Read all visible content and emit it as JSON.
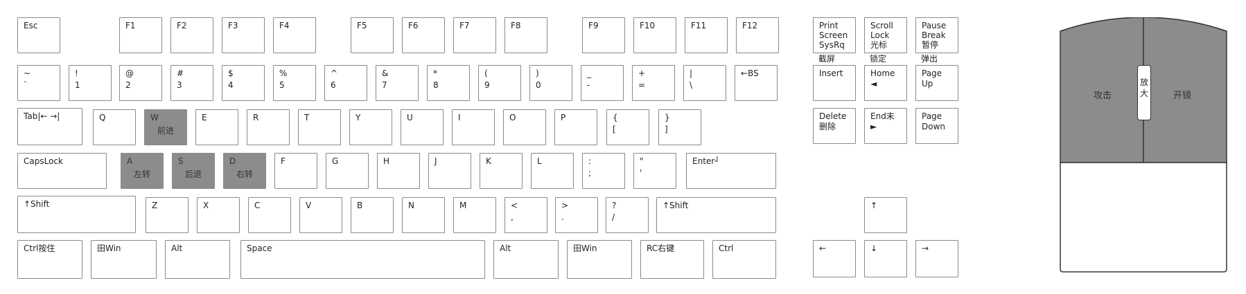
{
  "keyboard": {
    "esc": "Esc",
    "f1": "F1",
    "f2": "F2",
    "f3": "F3",
    "f4": "F4",
    "f5": "F5",
    "f6": "F6",
    "f7": "F7",
    "f8": "F8",
    "f9": "F9",
    "f10": "F10",
    "f11": "F11",
    "f12": "F12",
    "print": "Print\nScreen\nSysRq",
    "print_cn": "截屏",
    "scroll": "Scroll\nLock\n光标",
    "scroll_cn": "锁定",
    "pause": "Pause\nBreak\n暂停",
    "pause_cn": "弹出",
    "tilde_top": "~",
    "tilde_bot": "`",
    "n1_top": "!",
    "n1_bot": "1",
    "n2_top": "@",
    "n2_bot": "2",
    "n3_top": "#",
    "n3_bot": "3",
    "n4_top": "$",
    "n4_bot": "4",
    "n5_top": "%",
    "n5_bot": "5",
    "n6_top": "^",
    "n6_bot": "6",
    "n7_top": "&",
    "n7_bot": "7",
    "n8_top": "*",
    "n8_bot": "8",
    "n9_top": "(",
    "n9_bot": "9",
    "n0_top": ")",
    "n0_bot": "0",
    "minus_top": "_",
    "minus_bot": "-",
    "plus_top": "+",
    "plus_bot": "=",
    "pipe_top": "|",
    "pipe_bot": "\\",
    "backspace": "←BS",
    "insert": "Insert",
    "home": "Home\n◄",
    "pageup": "Page\nUp",
    "tab": "Tab|← →|",
    "q": "Q",
    "w": "W",
    "w_cn": "前进",
    "e": "E",
    "r": "R",
    "t": "T",
    "y": "Y",
    "u": "U",
    "i": "I",
    "o": "O",
    "p": "P",
    "lbrace_top": "{",
    "lbrace_bot": "[",
    "rbrace_top": "}",
    "rbrace_bot": "]",
    "delete": "Delete\n删除",
    "end": "End末\n►",
    "pagedown": "Page\nDown",
    "capslock": "CapsLock",
    "a": "A",
    "a_cn": "左转",
    "s": "S",
    "s_cn": "后退",
    "d": "D",
    "d_cn": "右转",
    "f": "F",
    "g": "G",
    "h": "H",
    "j": "J",
    "k": "K",
    "l": "L",
    "colon_top": ":",
    "colon_bot": ";",
    "quote_top": "\"",
    "quote_bot": "'",
    "enter": "Enter┘",
    "lshift": "↑Shift",
    "z": "Z",
    "x": "X",
    "c": "C",
    "v": "V",
    "b": "B",
    "n": "N",
    "m": "M",
    "lt_top": "<",
    "lt_bot": ",",
    "gt_top": ">",
    "gt_bot": ".",
    "q_top": "?",
    "q_bot": "/",
    "rshift": "↑Shift",
    "arrow_up": "↑",
    "lctrl": "Ctrl按住",
    "lwin": "田Win",
    "lalt": "Alt",
    "space": "Space",
    "ralt": "Alt",
    "rwin": "田Win",
    "rc": "RC右键",
    "rctrl": "Ctrl",
    "arrow_left": "←",
    "arrow_down": "↓",
    "arrow_right": "→"
  },
  "mouse": {
    "left_label": "攻击",
    "right_label": "开镜",
    "wheel_label": "放\n大"
  },
  "colors": {
    "highlight": "#8c8c8c",
    "border": "#8a8a8a",
    "mouse_top": "#8c8c8c"
  }
}
